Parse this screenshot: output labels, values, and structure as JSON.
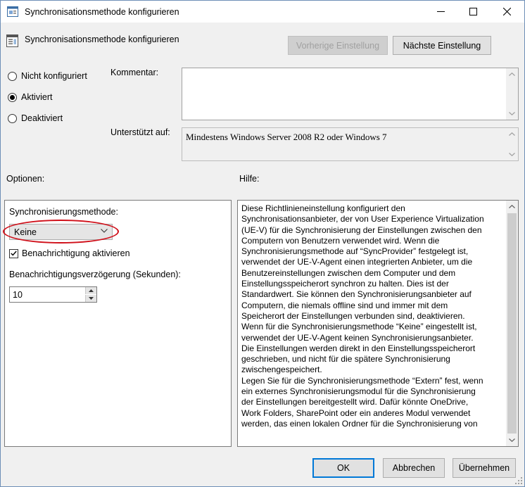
{
  "window": {
    "title": "Synchronisationsmethode konfigurieren"
  },
  "header": {
    "title": "Synchronisationsmethode konfigurieren",
    "prev_label": "Vorherige Einstellung",
    "next_label": "Nächste Einstellung"
  },
  "state": {
    "options": [
      {
        "label": "Nicht konfiguriert",
        "selected": false
      },
      {
        "label": "Aktiviert",
        "selected": true
      },
      {
        "label": "Deaktiviert",
        "selected": false
      }
    ]
  },
  "comment": {
    "label": "Kommentar:",
    "value": ""
  },
  "supported": {
    "label": "Unterstützt auf:",
    "value": "Mindestens Windows Server 2008 R2 oder Windows 7"
  },
  "options_section": {
    "label": "Optionen:",
    "sync_method_label": "Synchronisierungsmethode:",
    "sync_method_value": "Keine",
    "notification_label": "Benachrichtigung aktivieren",
    "notification_checked": true,
    "delay_label": "Benachrichtigungsverzögerung (Sekunden):",
    "delay_value": "10"
  },
  "help_section": {
    "label": "Hilfe:",
    "lines": [
      "Diese Richtlinieneinstellung konfiguriert den",
      "Synchronisationsanbieter, der von User Experience Virtualization",
      "(UE-V) für die Synchronisierung der Einstellungen zwischen den",
      "Computern von Benutzern verwendet wird. Wenn die",
      "Synchronisierungsmethode auf “SyncProvider” festgelegt ist,",
      "verwendet der UE-V-Agent einen integrierten Anbieter, um die",
      "Benutzereinstellungen zwischen dem Computer und dem",
      "Einstellungsspeicherort synchron zu halten. Dies ist der",
      "Standardwert. Sie können den Synchronisierungsanbieter auf",
      "Computern, die niemals offline sind und immer mit dem",
      "Speicherort der Einstellungen verbunden sind, deaktivieren.",
      "Wenn für die Synchronisierungsmethode  “Keine” eingestellt ist,",
      "verwendet der UE-V-Agent keinen Synchronisierungsanbieter.",
      "Die Einstellungen werden direkt in den Einstellungsspeicherort",
      "geschrieben, und nicht für die spätere Synchronisierung",
      "zwischengespeichert.",
      "Legen Sie für die Synchronisierungsmethode “Extern” fest, wenn",
      "ein externes Synchronisierungsmodul für die Synchronisierung",
      "der Einstellungen bereitgestellt wird. Dafür könnte OneDrive,",
      "Work Folders, SharePoint oder ein anderes Modul verwendet",
      "werden, das einen lokalen Ordner für die Synchronisierung von"
    ]
  },
  "footer": {
    "ok_label": "OK",
    "cancel_label": "Abbrechen",
    "apply_label": "Übernehmen"
  },
  "colors": {
    "annotation": "#d0101a",
    "default_button_border": "#0078d7"
  }
}
